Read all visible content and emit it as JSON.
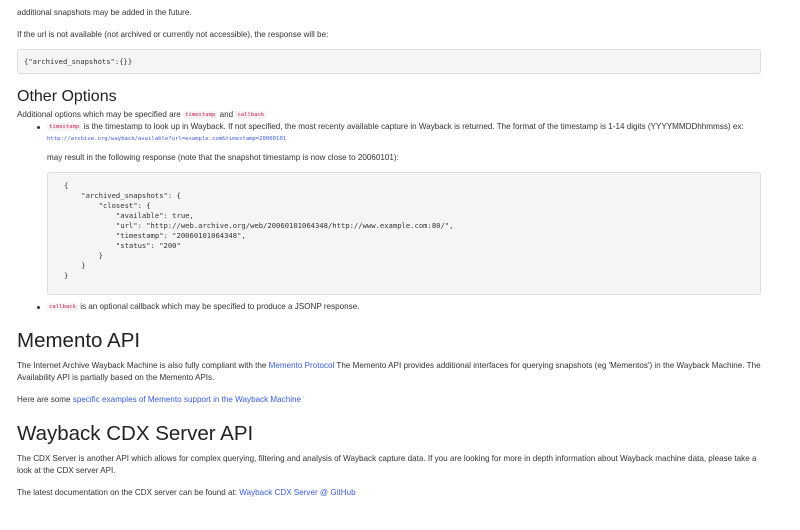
{
  "intro": {
    "line2": "additional snapshots may be added in the future."
  },
  "not_available": {
    "text": "If the url is not available (not archived or currently not accessible), the response will be:",
    "code": "{\"archived_snapshots\":{}}"
  },
  "other_options": {
    "heading": "Other Options",
    "text_before": "Additional options which may be specified are",
    "opt1": "timestamp",
    "and": "and",
    "opt2": "callback",
    "bullet1_code": "timestamp",
    "bullet1_text": "is the timestamp to look up in Wayback. If not specified, the most recenty available capture in Wayback is returned. The format of the timestamp is 1-14 digits (YYYYMMDDhhmmss) ex:",
    "bullet1_link": "http://archive.org/wayback/available?url=example.com&timestamp=20060101",
    "response_text": "may result in the following response (note that the snapshot timestamp is now close to 20060101):",
    "response_code": "{\n    \"archived_snapshots\": {\n        \"closest\": {\n            \"available\": true,\n            \"url\": \"http://web.archive.org/web/20060101064348/http://www.example.com:80/\",\n            \"timestamp\": \"20060101064348\",\n            \"status\": \"200\"\n        }\n    }\n}",
    "bullet2_code": "callback",
    "bullet2_text": "is an optional callback which may be specified to produce a JSONP response."
  },
  "memento": {
    "heading": "Memento API",
    "p1_before": "The Internet Archive Wayback Machine is also fully compliant with the",
    "p1_link": "Memento Protocol",
    "p1_after": "The Memento API provides additional interfaces for querying snapshots (eg 'Mementos') in the Wayback Machine. The Availability API is partially based on the Memento APIs.",
    "p2_before": "Here are some",
    "p2_link": "specific examples of Memento support in the Wayback Machine"
  },
  "cdx": {
    "heading": "Wayback CDX Server API",
    "p1": "The CDX Server is another API which allows for complex querying, filtering and analysis of Wayback capture data. If you are looking for more in depth information about Wayback machine data, please take a look at the CDX server API.",
    "p2_before": "The latest documentation on the CDX server can be found at:",
    "p2_link": "Wayback CDX Server @ GitHub"
  }
}
